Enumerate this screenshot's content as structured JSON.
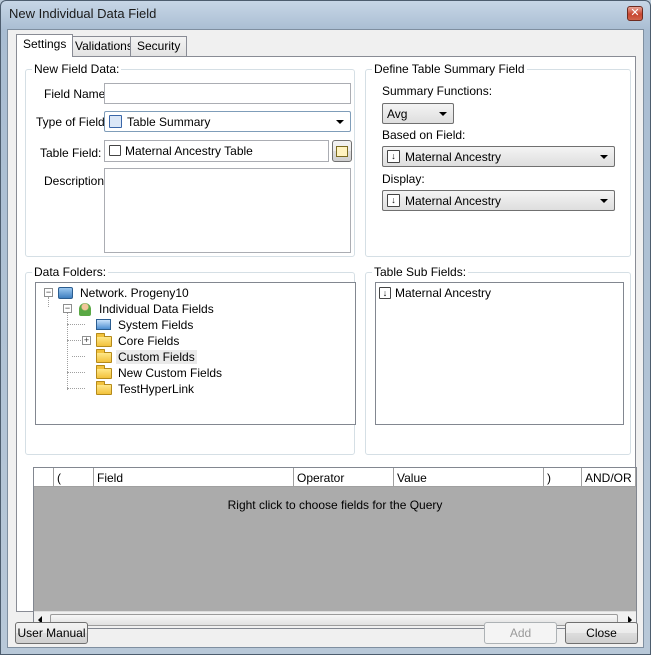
{
  "window": {
    "title": "New Individual Data Field"
  },
  "tabs": [
    {
      "label": "Settings"
    },
    {
      "label": "Validations"
    },
    {
      "label": "Security"
    }
  ],
  "new_field_data": {
    "group_label": "New Field Data:",
    "field_name_label": "Field Name:",
    "field_name_value": "",
    "type_label": "Type of Field:",
    "type_value": "Table Summary",
    "table_field_label": "Table Field:",
    "table_field_value": "Maternal Ancestry Table",
    "description_label": "Description:",
    "description_value": ""
  },
  "summary": {
    "group_label": "Define Table Summary Field",
    "functions_label": "Summary Functions:",
    "functions_value": "Avg",
    "based_on_label": "Based on Field:",
    "based_on_value": "Maternal Ancestry",
    "display_label": "Display:",
    "display_value": "Maternal Ancestry"
  },
  "data_folders": {
    "group_label": "Data Folders:",
    "root": "Network. Progeny10",
    "child": "Individual Data Fields",
    "items": [
      "System Fields",
      "Core Fields",
      "Custom Fields",
      "New Custom Fields",
      "TestHyperLink"
    ]
  },
  "sub_fields": {
    "group_label": "Table Sub Fields:",
    "items": [
      "Maternal Ancestry"
    ]
  },
  "query_grid": {
    "columns": [
      "(",
      "Field",
      "Operator",
      "Value",
      ")",
      "AND/OR"
    ],
    "empty_message": "Right click to choose fields for the Query"
  },
  "buttons": {
    "user_manual": "User Manual",
    "add": "Add",
    "close": "Close"
  }
}
